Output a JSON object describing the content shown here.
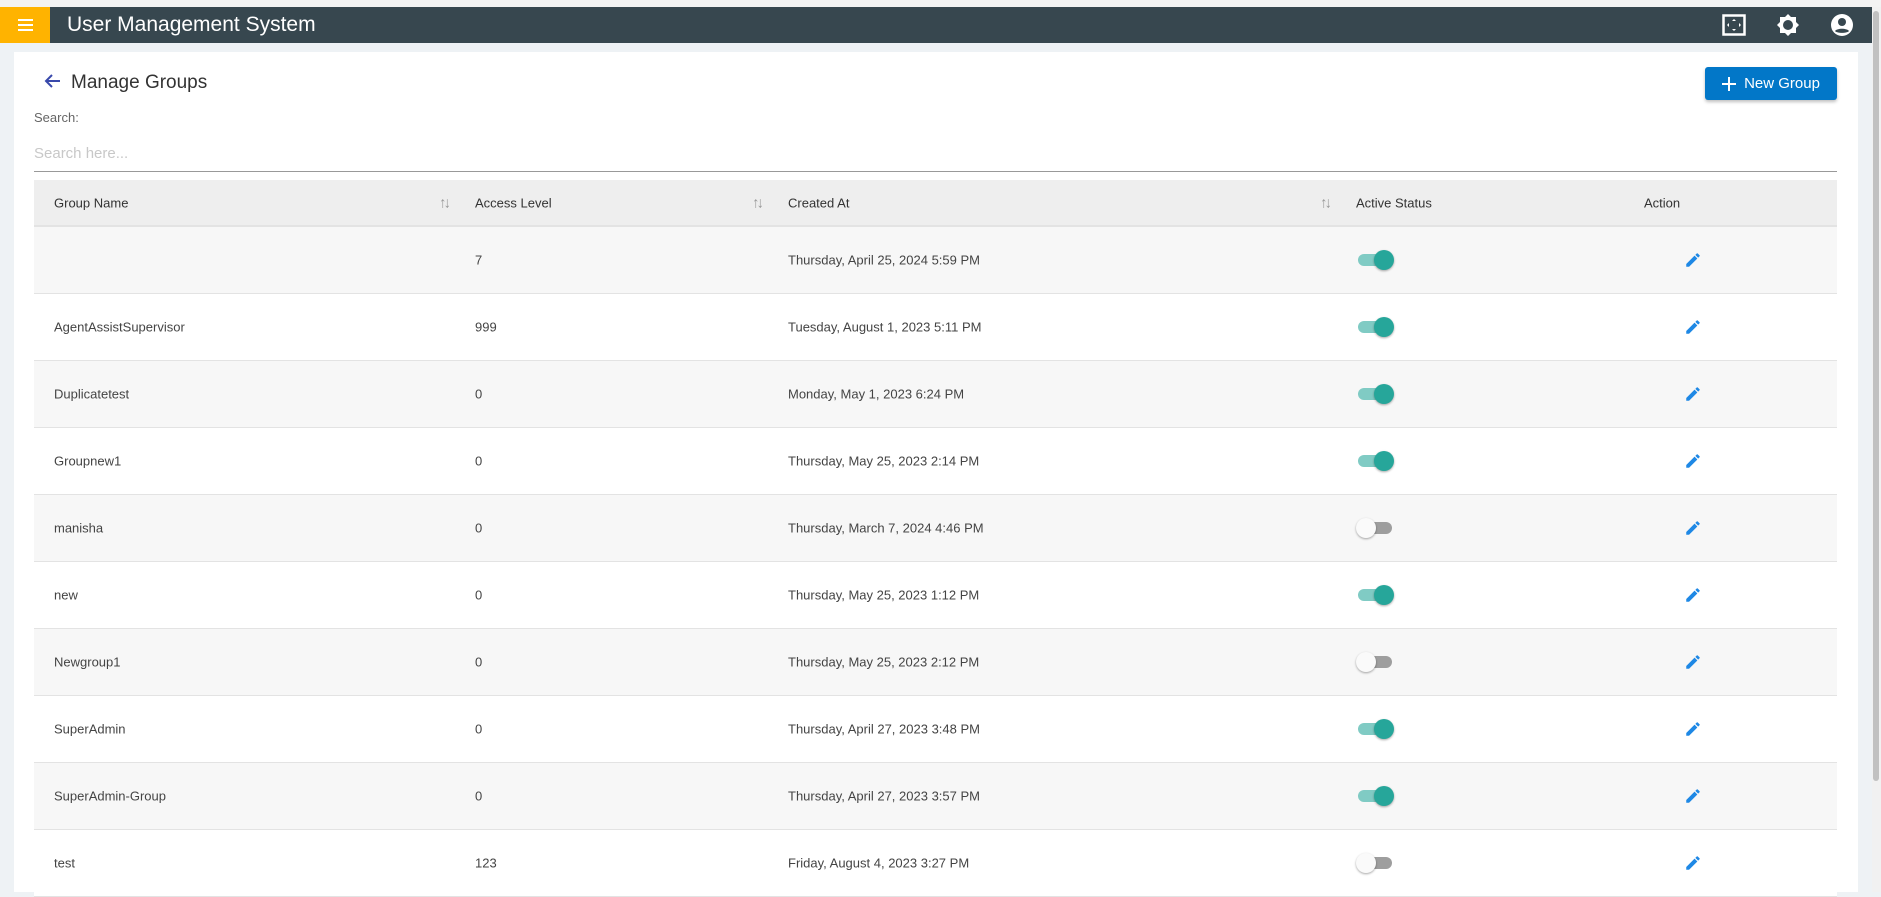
{
  "app": {
    "title": "User Management System"
  },
  "page": {
    "title": "Manage Groups",
    "new_button": "New Group"
  },
  "search": {
    "label": "Search:",
    "placeholder": "Search here...",
    "value": ""
  },
  "table": {
    "columns": [
      "Group Name",
      "Access Level",
      "Created At",
      "Active Status",
      "Action"
    ],
    "rows": [
      {
        "name": "",
        "access": "7",
        "created": "Thursday, April 25, 2024 5:59 PM",
        "active": true
      },
      {
        "name": "AgentAssistSupervisor",
        "access": "999",
        "created": "Tuesday, August 1, 2023 5:11 PM",
        "active": true
      },
      {
        "name": "Duplicatetest",
        "access": "0",
        "created": "Monday, May 1, 2023 6:24 PM",
        "active": true
      },
      {
        "name": "Groupnew1",
        "access": "0",
        "created": "Thursday, May 25, 2023 2:14 PM",
        "active": true
      },
      {
        "name": "manisha",
        "access": "0",
        "created": "Thursday, March 7, 2024 4:46 PM",
        "active": false
      },
      {
        "name": "new",
        "access": "0",
        "created": "Thursday, May 25, 2023 1:12 PM",
        "active": true
      },
      {
        "name": "Newgroup1",
        "access": "0",
        "created": "Thursday, May 25, 2023 2:12 PM",
        "active": false
      },
      {
        "name": "SuperAdmin",
        "access": "0",
        "created": "Thursday, April 27, 2023 3:48 PM",
        "active": true
      },
      {
        "name": "SuperAdmin-Group",
        "access": "0",
        "created": "Thursday, April 27, 2023 3:57 PM",
        "active": true
      },
      {
        "name": "test",
        "access": "123",
        "created": "Friday, August 4, 2023 3:27 PM",
        "active": false
      }
    ]
  },
  "colors": {
    "appbar": "#37474f",
    "menu": "#ffb300",
    "primary": "#0277c8",
    "toggle_on": "#26a69a",
    "edit": "#1e88e5"
  }
}
